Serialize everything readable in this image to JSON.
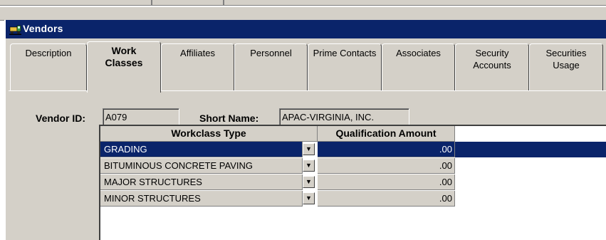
{
  "window": {
    "title": "Vendors",
    "icon": "truck-icon",
    "title_bar_color": "#0a246a"
  },
  "tabs": [
    {
      "label": "Description",
      "active": false
    },
    {
      "label": "Work Classes",
      "active": true
    },
    {
      "label": "Affiliates",
      "active": false
    },
    {
      "label": "Personnel",
      "active": false
    },
    {
      "label": "Prime Contacts",
      "active": false
    },
    {
      "label": "Associates",
      "active": false
    },
    {
      "label": "Security Accounts",
      "active": false
    },
    {
      "label": "Securities Usage",
      "active": false
    }
  ],
  "form": {
    "vendor_id_label": "Vendor ID:",
    "vendor_id_value": "A079",
    "short_name_label": "Short Name:",
    "short_name_value": "APAC-VIRGINIA, INC."
  },
  "grid": {
    "columns": {
      "type": "Workclass Type",
      "amount": "Qualification Amount"
    },
    "rows": [
      {
        "type": "GRADING",
        "amount": ".00",
        "selected": true
      },
      {
        "type": "BITUMINOUS CONCRETE PAVING",
        "amount": ".00",
        "selected": false
      },
      {
        "type": "MAJOR STRUCTURES",
        "amount": ".00",
        "selected": false
      },
      {
        "type": "MINOR STRUCTURES",
        "amount": ".00",
        "selected": false
      }
    ],
    "selection_color": "#0a246a"
  }
}
